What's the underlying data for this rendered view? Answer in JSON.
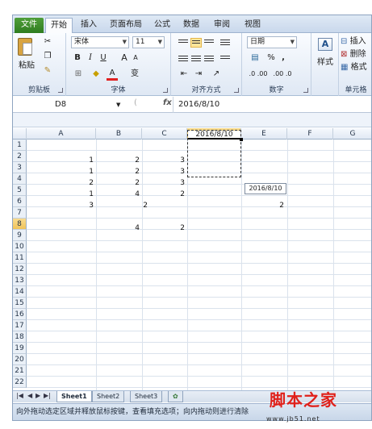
{
  "tabs": [
    "文件",
    "开始",
    "插入",
    "页面布局",
    "公式",
    "数据",
    "审阅",
    "视图"
  ],
  "ribbon": {
    "clipboard": {
      "label": "剪贴板",
      "paste": "粘贴"
    },
    "font": {
      "label": "字体",
      "name": "宋体",
      "size": "11",
      "bold": "B",
      "italic": "I",
      "underline": "U",
      "grow": "A",
      "shrink": "A",
      "color_a": "A",
      "phonetic": "变"
    },
    "alignment": {
      "label": "对齐方式"
    },
    "number": {
      "label": "数字",
      "format": "日期",
      "percent": "%",
      "comma": ",",
      "dec_inc": ".0 .00",
      "dec_dec": ".00 .0"
    },
    "styles": {
      "label": "样式"
    },
    "cells": {
      "label": "单元格",
      "insert": "插入",
      "delete": "删除",
      "format": "格式"
    }
  },
  "formula_bar": {
    "name_box": "D8",
    "fx": "fx",
    "value": "2016/8/10"
  },
  "columns": [
    "A",
    "B",
    "C",
    "D",
    "E",
    "F",
    "G"
  ],
  "rows": [
    "1",
    "2",
    "3",
    "4",
    "5",
    "6",
    "7",
    "8",
    "9",
    "10",
    "11",
    "12",
    "13",
    "14",
    "15",
    "16",
    "17",
    "18",
    "19",
    "20",
    "21",
    "22"
  ],
  "cells": {
    "r1": [
      "1",
      "2",
      "3"
    ],
    "r2": [
      "1",
      "2",
      "3"
    ],
    "r3": [
      "2",
      "2",
      "3"
    ],
    "r4": [
      "1",
      "4",
      "2"
    ],
    "r5": [
      "3",
      "2",
      "2"
    ],
    "r7": [
      "4",
      "2"
    ],
    "d8": "2016/8/10"
  },
  "tooltip": "2016/8/10",
  "sheets": [
    "Sheet1",
    "Sheet2",
    "Sheet3"
  ],
  "status": "向外拖动选定区域并释放鼠标按键，查看填充选项；向内拖动则进行清除",
  "watermark": {
    "title": "脚本之家",
    "url": "www.jb51.net"
  },
  "colors": {
    "file_tab": "#2f7d20",
    "selection": "#f0c35a",
    "watermark": "#e0201a"
  }
}
